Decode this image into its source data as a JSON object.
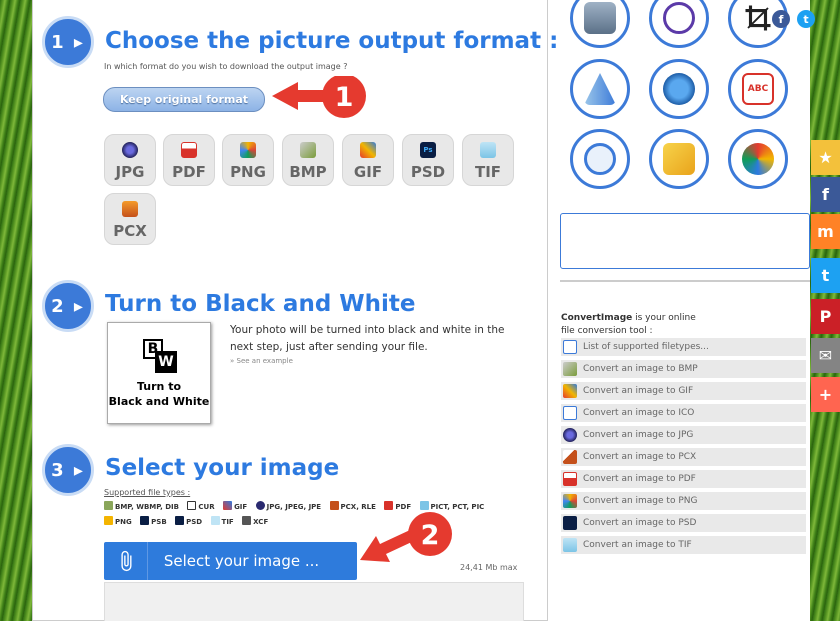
{
  "step1": {
    "number": "1 ▸",
    "title": "Choose the picture output format :",
    "subtitle": "In which format do you wish to download the output image ?",
    "keep_original": "Keep original format",
    "formats": [
      "JPG",
      "PDF",
      "PNG",
      "BMP",
      "GIF",
      "PSD",
      "TIF",
      "PCX"
    ],
    "annotation": "1"
  },
  "step2": {
    "number": "2 ▸",
    "title": "Turn to Black and White",
    "box_letters": [
      "B",
      "W"
    ],
    "box_caption_line1": "Turn to",
    "box_caption_line2": "Black and White",
    "description": "Your photo will be turned into black and white in the next step, just after sending your file.",
    "see_example": "» See an example"
  },
  "step3": {
    "number": "3 ▸",
    "title": "Select your image",
    "supported_label": "Supported file types :",
    "types_row1": [
      "BMP, WBMP, DIB",
      "CUR",
      "GIF",
      "JPG, JPEG, JPE",
      "PCX, RLE",
      "PDF",
      "PICT, PCT, PIC"
    ],
    "types_row2": [
      "PNG",
      "PSB",
      "PSD",
      "TIF",
      "XCF"
    ],
    "select_button": "Select your image ...",
    "max_size": "24,41 Mb max",
    "annotation": "2"
  },
  "sidebar": {
    "intro_brand": "ConvertImage",
    "intro_rest": " is your online",
    "intro_line2": "file conversion tool :",
    "links": [
      "List of supported filetypes...",
      "Convert an image to BMP",
      "Convert an image to GIF",
      "Convert an image to ICO",
      "Convert an image to JPG",
      "Convert an image to PCX",
      "Convert an image to PDF",
      "Convert an image to PNG",
      "Convert an image to PSD",
      "Convert an image to TIF"
    ]
  },
  "share_bar": {
    "icons": [
      "star-icon",
      "facebook-icon",
      "mix-icon",
      "twitter-icon",
      "pinterest-icon",
      "email-icon",
      "plus-icon"
    ],
    "glyphs": [
      "★",
      "f",
      "m",
      "t",
      "P",
      "✉",
      "+"
    ],
    "colors": [
      "#f3c13b",
      "#3b5998",
      "#ff8226",
      "#1da1f2",
      "#cb2027",
      "#848484",
      "#ff6550"
    ]
  },
  "colors": {
    "accent": "#3c7ad8",
    "title_blue": "#2d7ae0",
    "annotation_red": "#e53a2f"
  }
}
